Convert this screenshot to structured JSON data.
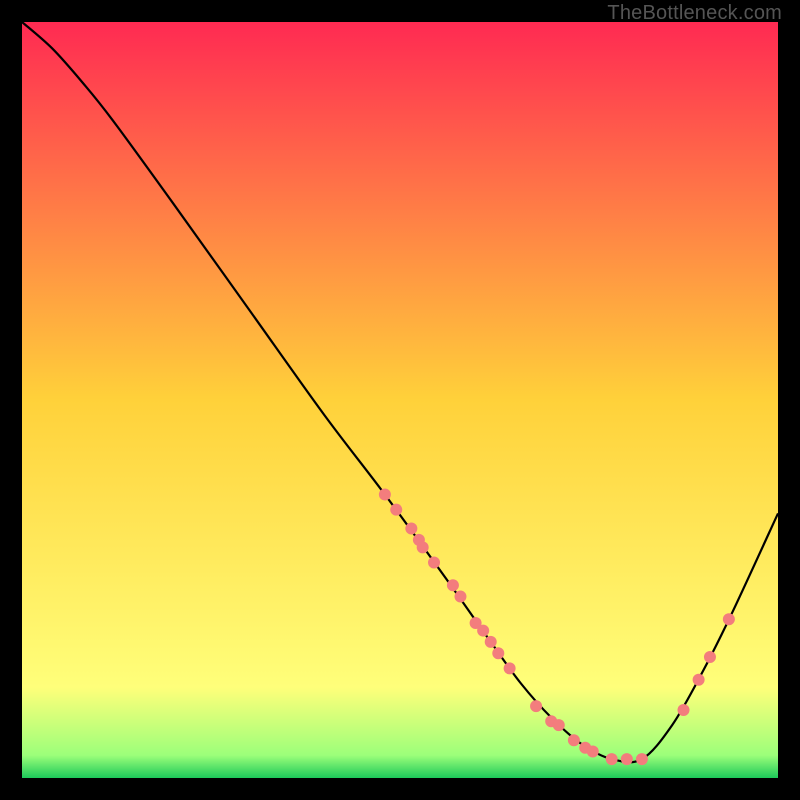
{
  "watermark": "TheBottleneck.com",
  "chart_data": {
    "type": "line",
    "title": "",
    "xlabel": "",
    "ylabel": "",
    "xlim": [
      0,
      100
    ],
    "ylim": [
      0,
      100
    ],
    "grid": false,
    "legend": false,
    "gradient_stops": [
      {
        "offset": 0.0,
        "color": "#ff2a52"
      },
      {
        "offset": 0.5,
        "color": "#ffd13a"
      },
      {
        "offset": 0.88,
        "color": "#ffff7a"
      },
      {
        "offset": 0.97,
        "color": "#9cff7a"
      },
      {
        "offset": 1.0,
        "color": "#1dc95a"
      }
    ],
    "series": [
      {
        "name": "bottleneck-curve",
        "color": "#000000",
        "x": [
          0.0,
          4.0,
          8.0,
          12.0,
          20.0,
          30.0,
          40.0,
          48.0,
          56.0,
          62.0,
          66.0,
          70.0,
          74.0,
          78.0,
          82.0,
          86.0,
          90.0,
          94.0,
          100.0
        ],
        "y": [
          100.0,
          96.5,
          92.0,
          87.0,
          76.0,
          62.0,
          48.0,
          37.5,
          26.5,
          18.0,
          12.5,
          8.0,
          4.5,
          2.5,
          2.5,
          7.0,
          14.0,
          22.0,
          35.0
        ]
      }
    ],
    "scatter": {
      "name": "highlight-points",
      "color": "#f37d7d",
      "radius": 6,
      "points": [
        {
          "x": 48.0,
          "y": 37.5
        },
        {
          "x": 49.5,
          "y": 35.5
        },
        {
          "x": 51.5,
          "y": 33.0
        },
        {
          "x": 52.5,
          "y": 31.5
        },
        {
          "x": 53.0,
          "y": 30.5
        },
        {
          "x": 54.5,
          "y": 28.5
        },
        {
          "x": 57.0,
          "y": 25.5
        },
        {
          "x": 58.0,
          "y": 24.0
        },
        {
          "x": 60.0,
          "y": 20.5
        },
        {
          "x": 61.0,
          "y": 19.5
        },
        {
          "x": 62.0,
          "y": 18.0
        },
        {
          "x": 63.0,
          "y": 16.5
        },
        {
          "x": 64.5,
          "y": 14.5
        },
        {
          "x": 68.0,
          "y": 9.5
        },
        {
          "x": 70.0,
          "y": 7.5
        },
        {
          "x": 71.0,
          "y": 7.0
        },
        {
          "x": 73.0,
          "y": 5.0
        },
        {
          "x": 74.5,
          "y": 4.0
        },
        {
          "x": 75.5,
          "y": 3.5
        },
        {
          "x": 78.0,
          "y": 2.5
        },
        {
          "x": 80.0,
          "y": 2.5
        },
        {
          "x": 82.0,
          "y": 2.5
        },
        {
          "x": 87.5,
          "y": 9.0
        },
        {
          "x": 89.5,
          "y": 13.0
        },
        {
          "x": 91.0,
          "y": 16.0
        },
        {
          "x": 93.5,
          "y": 21.0
        }
      ]
    }
  }
}
